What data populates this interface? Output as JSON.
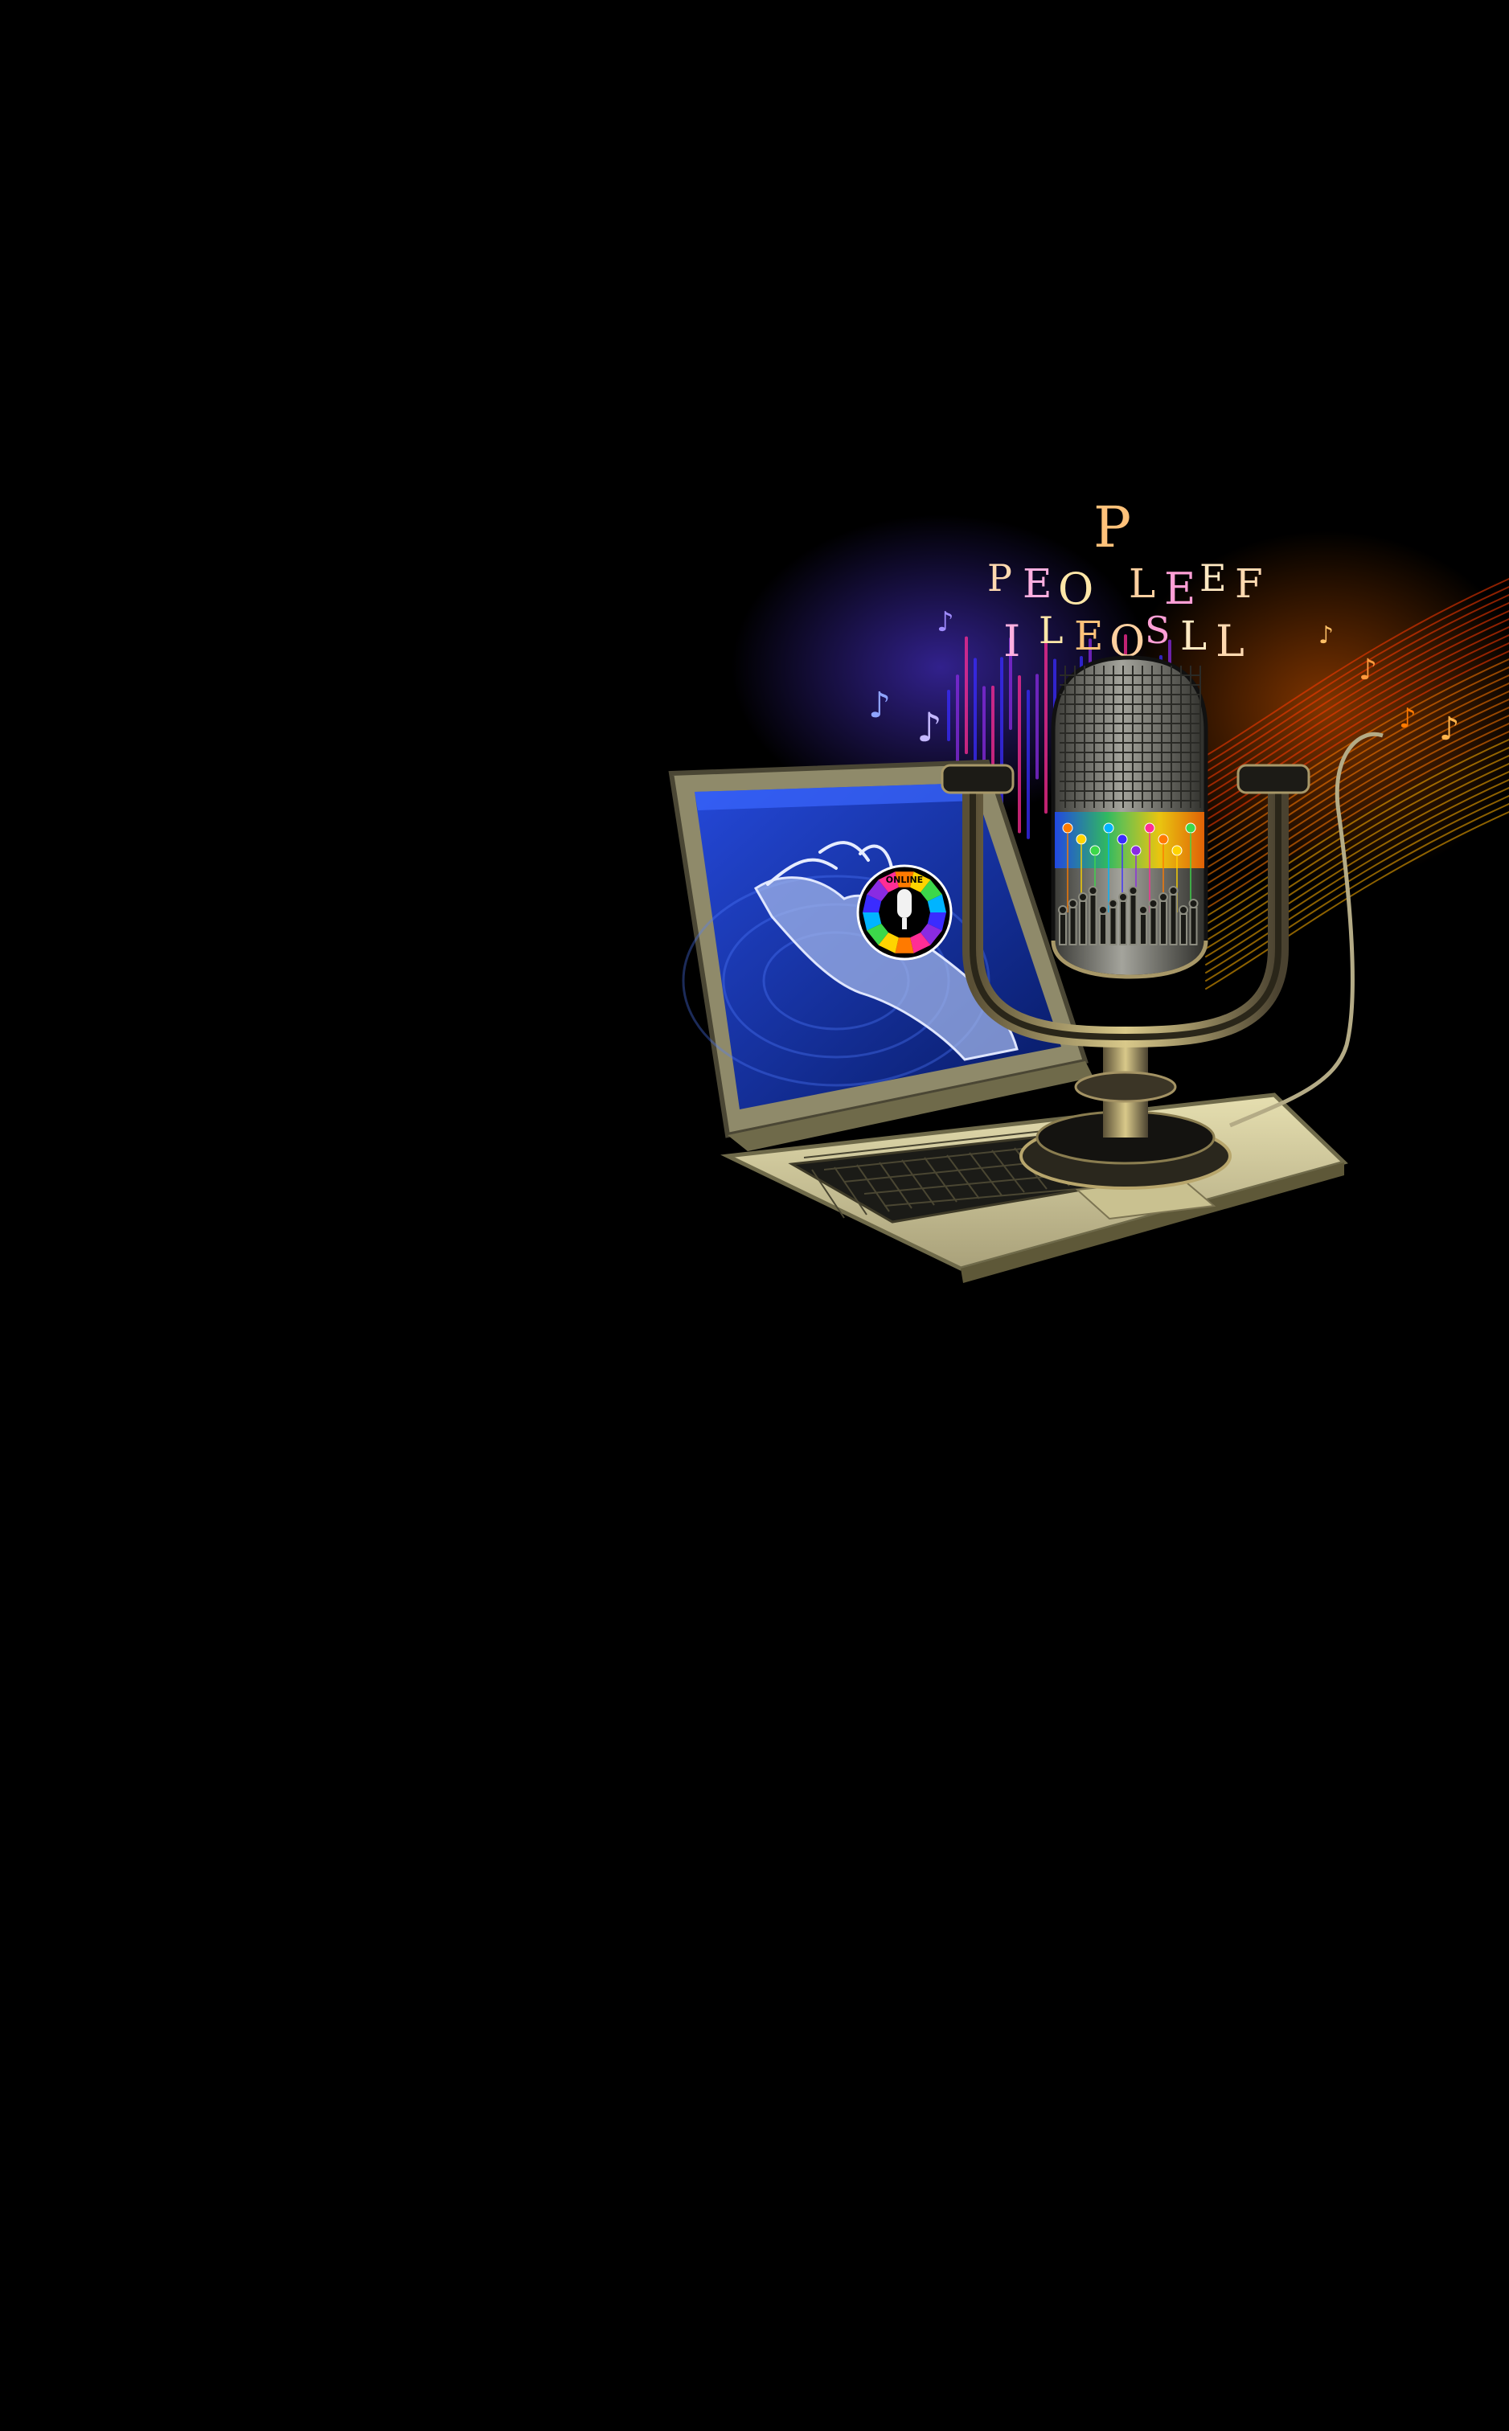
{
  "image": {
    "background": "#000000",
    "subject": "laptop-with-vintage-microphone",
    "screen_badge_text": "ONLINE"
  },
  "floating_letters": [
    "P",
    "E",
    "O",
    "P",
    "L",
    "E",
    "E",
    "F",
    "I",
    "L",
    "E",
    "O",
    "S",
    "L",
    "L"
  ],
  "colors": {
    "laptop_body": "#d6cfa0",
    "laptop_edge": "#6f6a4a",
    "screen_blue": "#1c3fb8",
    "screen_dark": "#071a63",
    "mic_metal": "#8b8b85",
    "mic_dark": "#1a1a18",
    "stand_gold": "#b8a66c",
    "spectrum": [
      "#3a2cff",
      "#8a2be2",
      "#ff2d95",
      "#ff7a00",
      "#ffd400",
      "#3cd84a",
      "#00b4ff"
    ]
  }
}
